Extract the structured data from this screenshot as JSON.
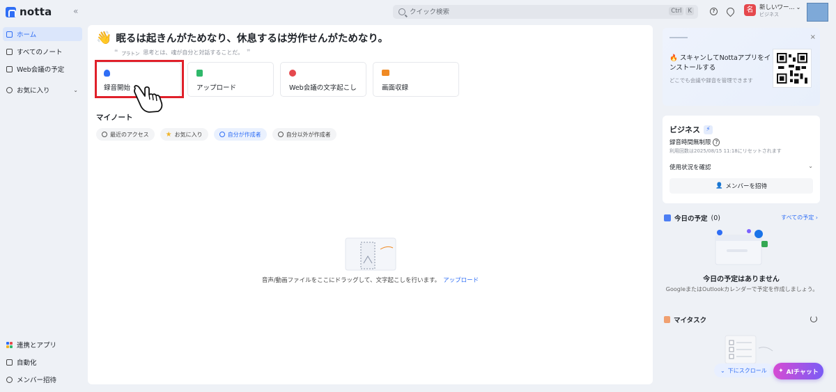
{
  "app": {
    "name": "notta"
  },
  "topbar": {
    "search_placeholder": "クイック検索",
    "shortcut_keys": [
      "Ctrl",
      "K"
    ],
    "workspace_avatar": "名",
    "workspace_name": "新しいワー...",
    "workspace_plan": "ビジネス"
  },
  "sidebar": {
    "items": [
      {
        "label": "ホーム"
      },
      {
        "label": "すべてのノート"
      },
      {
        "label": "Web会議の予定"
      },
      {
        "label": "お気に入り"
      }
    ],
    "bottom_items": [
      {
        "label": "連携とアプリ"
      },
      {
        "label": "自動化"
      },
      {
        "label": "メンバー招待"
      }
    ]
  },
  "main": {
    "hero_title": "眠るは起きんがためなり、休息するは労作せんがためなり。",
    "quote_author": "プラトン",
    "quote_text": "思考とは、魂が自分と対話することだ。",
    "cards": [
      {
        "label": "録音開始",
        "color": "#2f6ef5"
      },
      {
        "label": "アップロード",
        "color": "#2fb86a"
      },
      {
        "label": "Web会議の文字起こし",
        "color": "#e5484d"
      },
      {
        "label": "画面収録",
        "color": "#f08a24"
      }
    ],
    "section_title": "マイノート",
    "filters": [
      {
        "label": "最近のアクセス"
      },
      {
        "label": "お気に入り"
      },
      {
        "label": "自分が作成者"
      },
      {
        "label": "自分以外が作成者"
      }
    ],
    "empty_text": "音声/動画ファイルをここにドラッグして、文字起こしを行います。",
    "empty_link": "アップロード"
  },
  "right": {
    "promo": {
      "title": "スキャンしてNottaアプリをインストールする",
      "subtitle": "どこでも会議や録音を管理できます"
    },
    "plan": {
      "title": "ビジネス",
      "recording": "録音時間無制限",
      "reset": "利用回数は2025/08/15 11:18にリセットされます",
      "usage": "使用状況を確認",
      "invite": "メンバーを招待"
    },
    "calendar": {
      "title": "今日の予定",
      "count": "(0)",
      "all_link": "すべての予定",
      "empty": "今日の予定はありません",
      "hint": "GoogleまたはOutlookカレンダーで予定を作成しましょう。"
    },
    "tasks": {
      "title": "マイタスク",
      "scroll": "下にスクロール"
    }
  },
  "ai_chat": {
    "label": "AIチャット"
  },
  "colors": {
    "accent": "#2f6ef5",
    "highlight": "#e0202a"
  }
}
